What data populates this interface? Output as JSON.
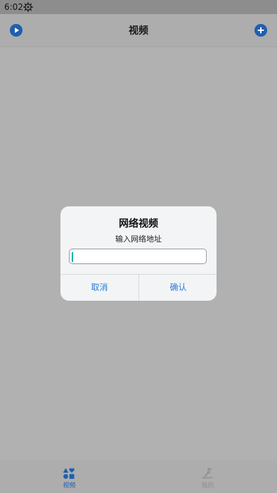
{
  "status_bar": {
    "time": "6:02",
    "icons": [
      "gear-icon"
    ]
  },
  "header": {
    "title": "视频",
    "left_icon": "play-circle-icon",
    "right_icon": "plus-circle-icon"
  },
  "dialog": {
    "title": "网络视频",
    "message": "输入网络地址",
    "input": {
      "value": "",
      "placeholder": ""
    },
    "cancel_label": "取消",
    "confirm_label": "确认"
  },
  "tabs": [
    {
      "label": "视频",
      "icon": "shapes-icon",
      "active": true
    },
    {
      "label": "我的",
      "icon": "user-rowing-icon",
      "active": false
    }
  ],
  "colors": {
    "accent": "#1f5fae",
    "dialog_button": "#2b7cd3",
    "caret": "#17b3a3"
  }
}
